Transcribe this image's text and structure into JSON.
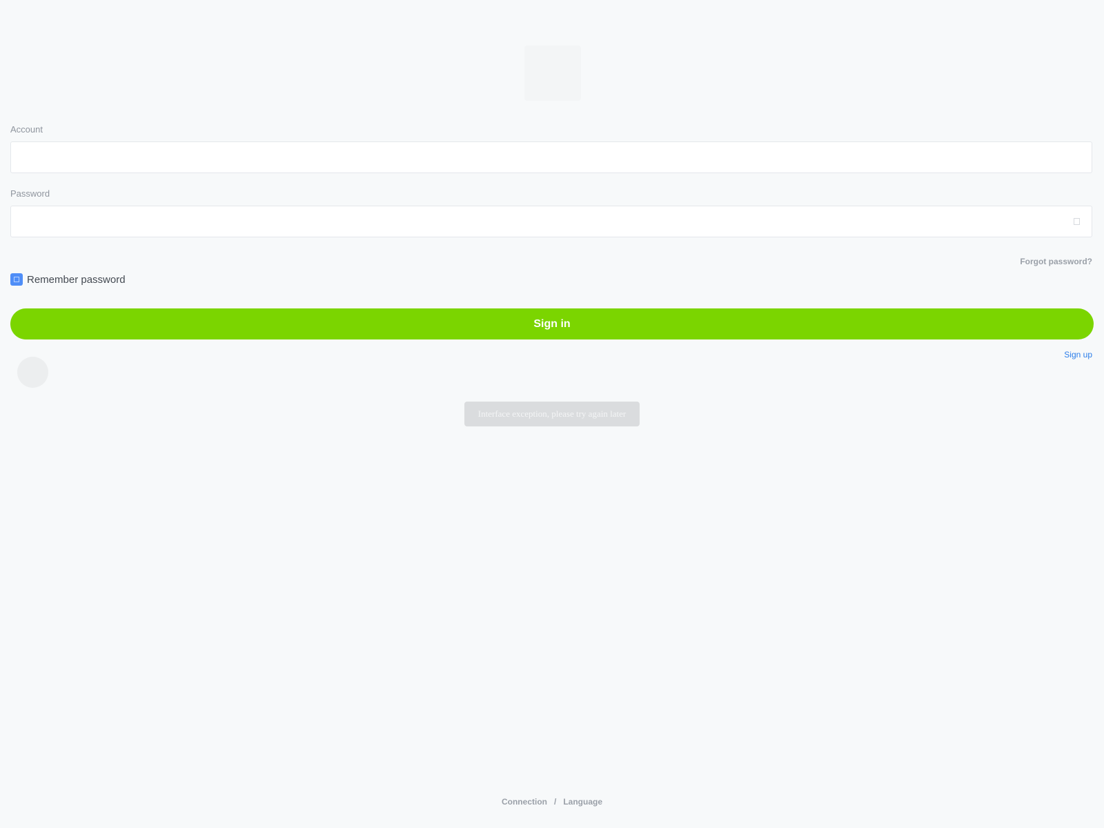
{
  "logo": {
    "icon": "app-logo"
  },
  "account": {
    "label": "Account",
    "value": "",
    "placeholder": ""
  },
  "password": {
    "label": "Password",
    "value": "",
    "placeholder": "",
    "toggle_icon": "eye-icon"
  },
  "forgot_password": "Forgot password?",
  "remember": {
    "label": "Remember password",
    "checked": true,
    "color": "#4f8ef7"
  },
  "signin": {
    "label": "Sign in",
    "color": "#7bd500"
  },
  "signup": "Sign up",
  "toast": "Interface exception, please try again later",
  "footer": {
    "connection": "Connection",
    "separator": "/",
    "language": "Language"
  }
}
